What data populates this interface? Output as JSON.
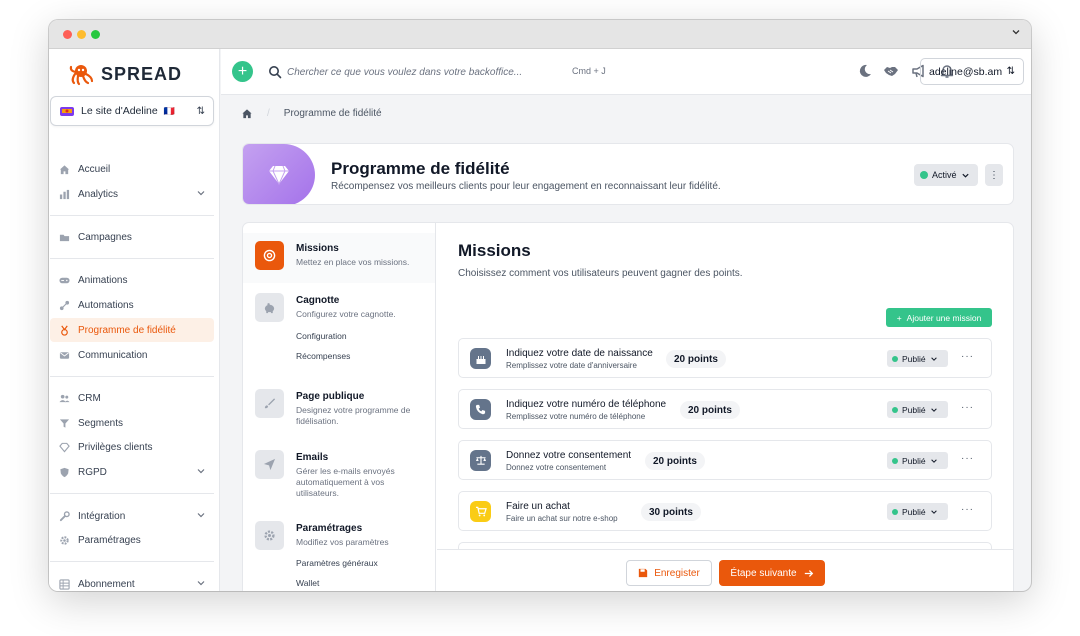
{
  "app": {
    "name": "SPREAD"
  },
  "site_select": {
    "label": "Le site d'Adeline",
    "flag": "🇫🇷"
  },
  "sidebar": {
    "items": [
      {
        "label": "Accueil",
        "icon": "home-icon"
      },
      {
        "label": "Analytics",
        "icon": "chart-icon"
      },
      {
        "label": "Campagnes",
        "icon": "folder-icon"
      },
      {
        "label": "Animations",
        "icon": "gamepad-icon"
      },
      {
        "label": "Automations",
        "icon": "automation-icon"
      },
      {
        "label": "Programme de fidélité",
        "icon": "medal-icon"
      },
      {
        "label": "Communication",
        "icon": "mail-icon"
      },
      {
        "label": "CRM",
        "icon": "users-icon"
      },
      {
        "label": "Segments",
        "icon": "filter-icon"
      },
      {
        "label": "Privilèges clients",
        "icon": "diamond-icon"
      },
      {
        "label": "RGPD",
        "icon": "shield-icon"
      },
      {
        "label": "Intégration",
        "icon": "wrench-icon"
      },
      {
        "label": "Paramétrages",
        "icon": "gear-icon"
      },
      {
        "label": "Abonnement",
        "icon": "grid-icon"
      }
    ]
  },
  "topbar": {
    "search_placeholder": "Chercher ce que vous voulez dans votre backoffice...",
    "shortcut": "Cmd + J",
    "user": "adeline@sb.am"
  },
  "breadcrumb": {
    "current": "Programme de fidélité"
  },
  "hero": {
    "title": "Programme de fidélité",
    "subtitle": "Récompensez vos meilleurs clients pour leur engagement en reconnaissant leur fidélité.",
    "status": "Activé"
  },
  "steps": [
    {
      "title": "Missions",
      "desc": "Mettez en place vos missions."
    },
    {
      "title": "Cagnotte",
      "desc": "Configurez votre cagnotte.",
      "subs": [
        "Configuration",
        "Récompenses"
      ]
    },
    {
      "title": "Page publique",
      "desc": "Designez votre programme de fidélisation."
    },
    {
      "title": "Emails",
      "desc": "Gérer les e-mails envoyés automatiquement à vos utilisateurs."
    },
    {
      "title": "Paramétrages",
      "desc": "Modifiez vos paramètres",
      "subs": [
        "Paramètres généraux",
        "Wallet"
      ]
    }
  ],
  "missions": {
    "title": "Missions",
    "subtitle": "Choisissez comment vos utilisateurs peuvent gagner des points.",
    "add_label": "Ajouter une mission",
    "status_label": "Publié",
    "items": [
      {
        "title": "Indiquez votre date de naissance",
        "desc": "Remplissez votre date d'anniversaire",
        "points": "20 points",
        "color": "#64748b"
      },
      {
        "title": "Indiquez votre numéro de téléphone",
        "desc": "Remplissez votre numéro de téléphone",
        "points": "20 points",
        "color": "#64748b"
      },
      {
        "title": "Donnez votre consentement",
        "desc": "Donnez votre consentement",
        "points": "20 points",
        "color": "#64748b"
      },
      {
        "title": "Faire un achat",
        "desc": "Faire un achat sur notre e-shop",
        "points": "30 points",
        "color": "#facc15"
      }
    ]
  },
  "footer": {
    "save_label": "Enregister",
    "next_label": "Étape suivante"
  },
  "colors": {
    "accent": "#ea580c",
    "green": "#34c48b",
    "purple": "#a472ea"
  }
}
